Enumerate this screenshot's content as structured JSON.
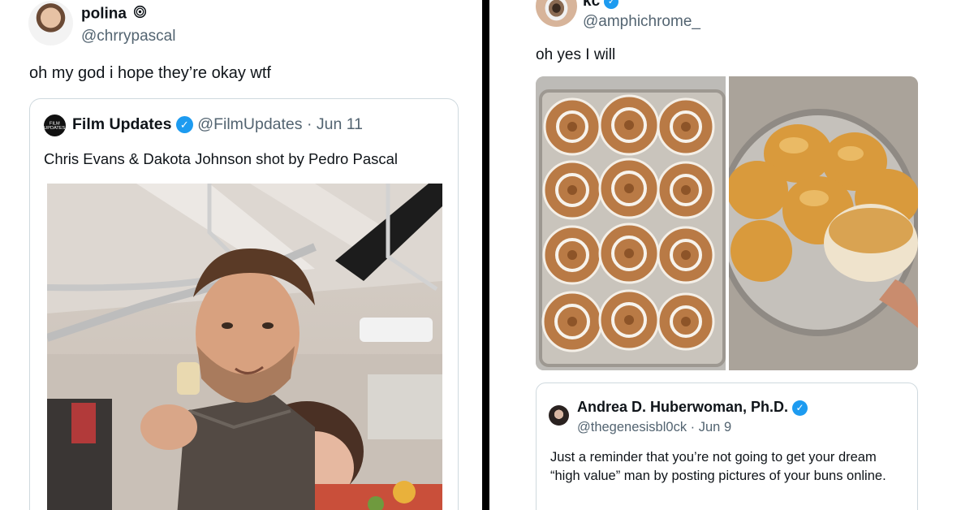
{
  "left_tweet": {
    "author_name": "polina",
    "author_badge_icon": "spiral-icon",
    "author_handle": "@chrrypascal",
    "text": "oh my god i hope they’re okay wtf",
    "quoted": {
      "author_name": "Film Updates",
      "logo_text": "FILM UPDATES",
      "author_handle": "@FilmUpdates",
      "date": "· Jun 11",
      "text": "Chris Evans & Dakota Johnson shot by Pedro Pascal"
    }
  },
  "right_tweet": {
    "author_name": "kc",
    "author_handle": "@amphichrome_",
    "text": "oh yes I will",
    "quoted": {
      "author_name": "Andrea D. Huberwoman, Ph.D.",
      "author_handle": "@thegenesisbl0ck",
      "date": "· Jun 9",
      "text": "Just a reminder that you’re not going to get your dream “high value” man by posting pictures of your buns online."
    }
  },
  "colors": {
    "verified_blue": "#1d9bf0",
    "handle_gray": "#536471",
    "border_gray": "#cfd9de",
    "divider_black": "#000000"
  }
}
